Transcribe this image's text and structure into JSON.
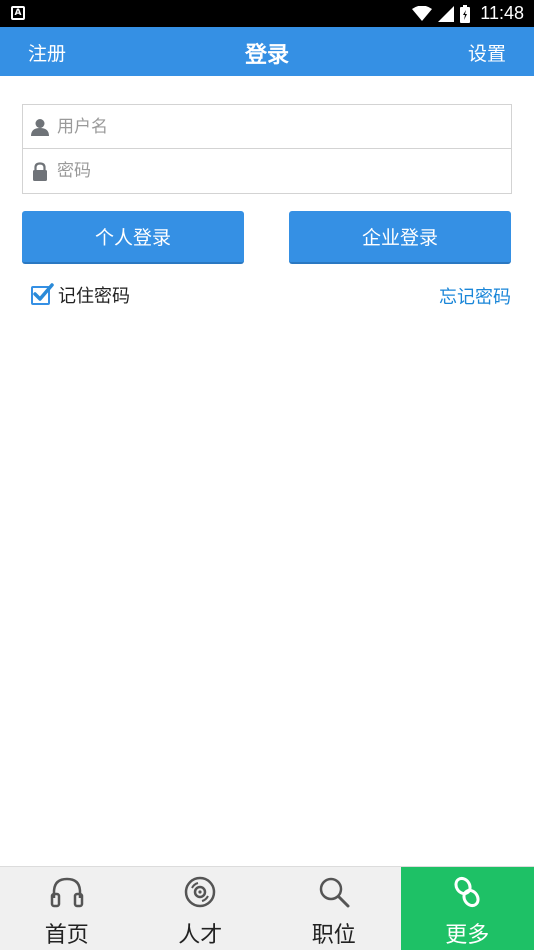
{
  "status_bar": {
    "time": "11:48",
    "left_icon_letter": "A"
  },
  "header": {
    "left_label": "注册",
    "title": "登录",
    "right_label": "设置"
  },
  "form": {
    "username_placeholder": "用户名",
    "password_placeholder": "密码",
    "username_value": "",
    "password_value": ""
  },
  "buttons": {
    "personal_login": "个人登录",
    "company_login": "企业登录"
  },
  "options": {
    "remember_password": "记住密码",
    "remember_checked": true,
    "forgot_password": "忘记密码"
  },
  "bottom_nav": {
    "items": [
      {
        "label": "首页",
        "icon": "headphones-icon"
      },
      {
        "label": "人才",
        "icon": "disc-icon"
      },
      {
        "label": "职位",
        "icon": "search-icon"
      },
      {
        "label": "更多",
        "icon": "link-icon",
        "active": true
      }
    ]
  },
  "colors": {
    "primary": "#3590e4",
    "active_nav": "#1ec166",
    "link": "#1a86d8"
  }
}
